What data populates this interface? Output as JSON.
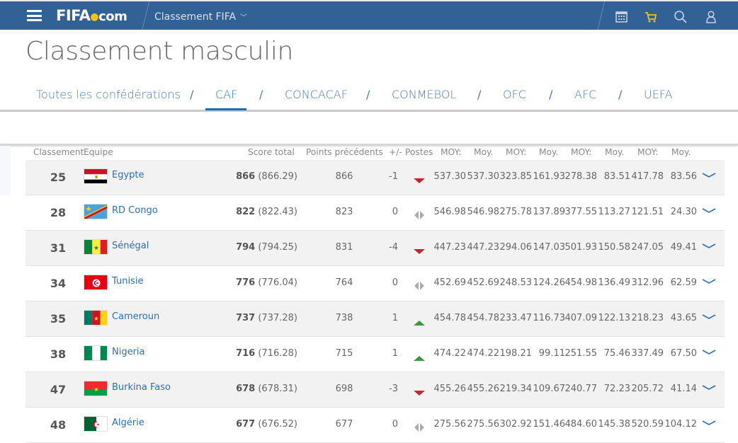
{
  "header": {
    "logo_main": "FIFA",
    "logo_suffix": "com",
    "breadcrumb": "Classement FIFA",
    "icons": [
      "menu-icon",
      "calendar-icon",
      "cart-icon",
      "search-icon",
      "user-icon"
    ],
    "cart_color": "#f0c419",
    "bar_color": "#326295"
  },
  "page": {
    "title": "Classement masculin"
  },
  "tabs": [
    {
      "label": "Toutes les confédérations",
      "active": false
    },
    {
      "label": "CAF",
      "active": true
    },
    {
      "label": "CONCACAF",
      "active": false
    },
    {
      "label": "CONMEBOL",
      "active": false
    },
    {
      "label": "OFC",
      "active": false
    },
    {
      "label": "AFC",
      "active": false
    },
    {
      "label": "UEFA",
      "active": false
    }
  ],
  "tab_separator": "/",
  "table": {
    "headers": {
      "rank": "Classement",
      "team": "Equipe",
      "score": "Score total",
      "prev": "Points précédents",
      "diff": "+/-",
      "postes": "Postes",
      "cols": [
        "MOY:",
        "Moy.",
        "MOY:",
        "Moy.",
        "MOY:",
        "Moy.",
        "MOY:",
        "Moy."
      ]
    },
    "rows": [
      {
        "rank": "25",
        "team": "Egypte",
        "flag": "egypt",
        "score": "866",
        "score_exact": "(866.29)",
        "prev": "866",
        "diff": "-1",
        "trend": "down",
        "values": [
          "537.30",
          "537.30",
          "323.85",
          "161.93",
          "278.38",
          "83.51",
          "417.78",
          "83.56"
        ]
      },
      {
        "rank": "28",
        "team": "RD Congo",
        "flag": "drc",
        "score": "822",
        "score_exact": "(822.43)",
        "prev": "823",
        "diff": "0",
        "trend": "same",
        "values": [
          "546.98",
          "546.98",
          "275.78",
          "137.89",
          "377.55",
          "113.27",
          "121.51",
          "24.30"
        ]
      },
      {
        "rank": "31",
        "team": "Sénégal",
        "flag": "senegal",
        "score": "794",
        "score_exact": "(794.25)",
        "prev": "831",
        "diff": "-4",
        "trend": "down",
        "values": [
          "447.23",
          "447.23",
          "294.06",
          "147.03",
          "501.93",
          "150.58",
          "247.05",
          "49.41"
        ]
      },
      {
        "rank": "34",
        "team": "Tunisie",
        "flag": "tunisia",
        "score": "776",
        "score_exact": "(776.04)",
        "prev": "764",
        "diff": "0",
        "trend": "same",
        "values": [
          "452.69",
          "452.69",
          "248.53",
          "124.26",
          "454.98",
          "136.49",
          "312.96",
          "62.59"
        ]
      },
      {
        "rank": "35",
        "team": "Cameroun",
        "flag": "cameroon",
        "score": "737",
        "score_exact": "(737.28)",
        "prev": "738",
        "diff": "1",
        "trend": "up",
        "values": [
          "454.78",
          "454.78",
          "233.47",
          "116.73",
          "407.09",
          "122.13",
          "218.23",
          "43.65"
        ]
      },
      {
        "rank": "38",
        "team": "Nigeria",
        "flag": "nigeria",
        "score": "716",
        "score_exact": "(716.28)",
        "prev": "715",
        "diff": "1",
        "trend": "up",
        "values": [
          "474.22",
          "474.22",
          "198.21",
          "99.11",
          "251.55",
          "75.46",
          "337.49",
          "67.50"
        ]
      },
      {
        "rank": "47",
        "team": "Burkina Faso",
        "flag": "burkina",
        "score": "678",
        "score_exact": "(678.31)",
        "prev": "698",
        "diff": "-3",
        "trend": "down",
        "values": [
          "455.26",
          "455.26",
          "219.34",
          "109.67",
          "240.77",
          "72.23",
          "205.72",
          "41.14"
        ]
      },
      {
        "rank": "48",
        "team": "Algérie",
        "flag": "algeria",
        "score": "677",
        "score_exact": "(676.52)",
        "prev": "677",
        "diff": "0",
        "trend": "same",
        "values": [
          "275.56",
          "275.56",
          "302.92",
          "151.46",
          "484.60",
          "145.38",
          "520.59",
          "104.12"
        ]
      }
    ]
  },
  "colors": {
    "up": "#3a9a3a",
    "down": "#c0272d",
    "same": "#aaaaaa",
    "link": "#2c6fb0",
    "tab_active_underline": "#1b6fb5"
  }
}
